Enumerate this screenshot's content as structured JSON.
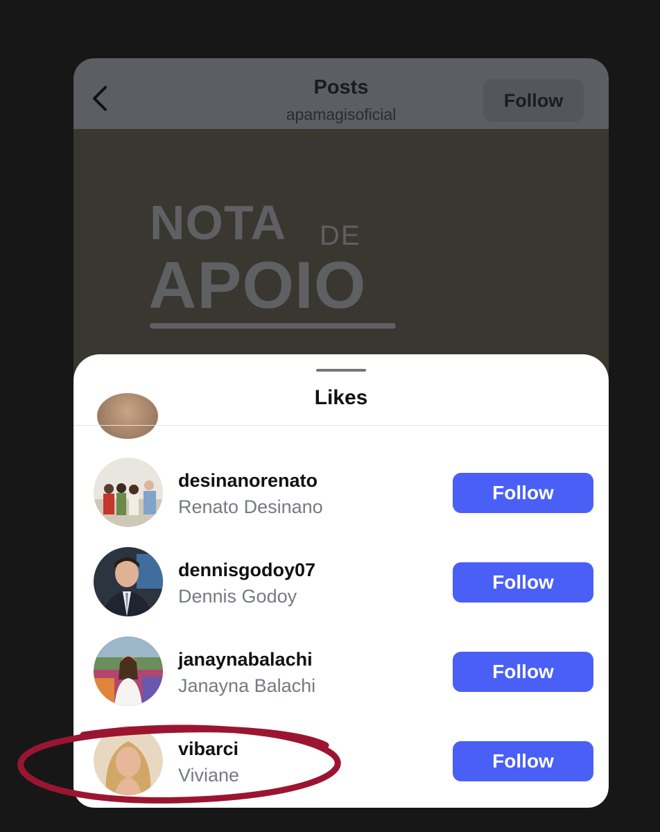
{
  "header": {
    "title": "Posts",
    "subtitle": "apamagisoficial",
    "follow_label": "Follow"
  },
  "post_image": {
    "line1_big": "NOTA",
    "line1_small": "DE",
    "line2": "APOIO"
  },
  "sheet": {
    "title": "Likes"
  },
  "likes": [
    {
      "username": "desinanorenato",
      "full_name": "Renato Desinano",
      "button": "Follow"
    },
    {
      "username": "dennisgodoy07",
      "full_name": "Dennis Godoy",
      "button": "Follow"
    },
    {
      "username": "janaynabalachi",
      "full_name": "Janayna Balachi",
      "button": "Follow"
    },
    {
      "username": "vibarci",
      "full_name": "Viviane",
      "button": "Follow"
    }
  ],
  "colors": {
    "follow_button": "#4a5ff5",
    "annotation_circle": "#9b1530"
  }
}
